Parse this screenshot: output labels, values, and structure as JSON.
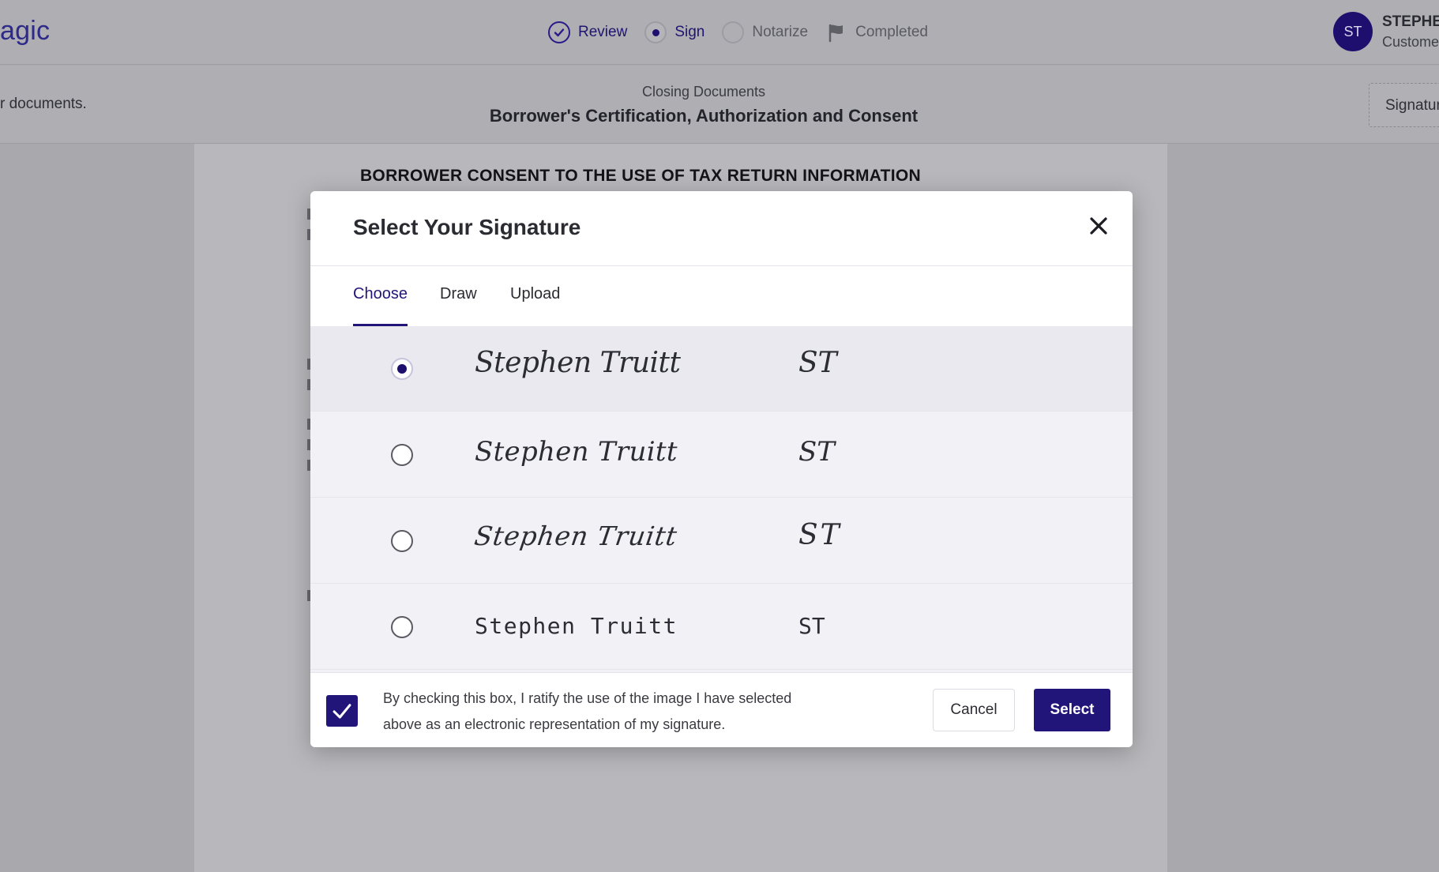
{
  "app": {
    "brand_fragment": "agic"
  },
  "steps": [
    {
      "label": "Review",
      "state": "done"
    },
    {
      "label": "Sign",
      "state": "current"
    },
    {
      "label": "Notarize",
      "state": "pending"
    },
    {
      "label": "Completed",
      "state": "pending"
    }
  ],
  "user": {
    "initials": "ST",
    "name": "STEPHE",
    "role": "Custome"
  },
  "subheader": {
    "left_text": "r documents.",
    "kicker": "Closing Documents",
    "title": "Borrower's Certification, Authorization and Consent",
    "right_button": "Signatur"
  },
  "document": {
    "heading": "BORROWER CONSENT TO THE USE OF TAX RETURN INFORMATION"
  },
  "modal": {
    "title": "Select Your Signature",
    "tabs": [
      {
        "label": "Choose",
        "active": true
      },
      {
        "label": "Draw",
        "active": false
      },
      {
        "label": "Upload",
        "active": false
      }
    ],
    "options": [
      {
        "name": "Stephen Truitt",
        "initials": "ST",
        "selected": true
      },
      {
        "name": "Stephen Truitt",
        "initials": "ST",
        "selected": false
      },
      {
        "name": "Stephen Truitt",
        "initials": "ST",
        "selected": false
      },
      {
        "name": "Stephen Truitt",
        "initials": "ST",
        "selected": false
      }
    ],
    "consent_text": "By checking this box, I ratify the use of the image I have selected above as an electronic representation of my signature.",
    "consent_checked": true,
    "cancel_label": "Cancel",
    "select_label": "Select"
  },
  "colors": {
    "accent": "#22157a",
    "overlay": "#a9a9ad"
  }
}
